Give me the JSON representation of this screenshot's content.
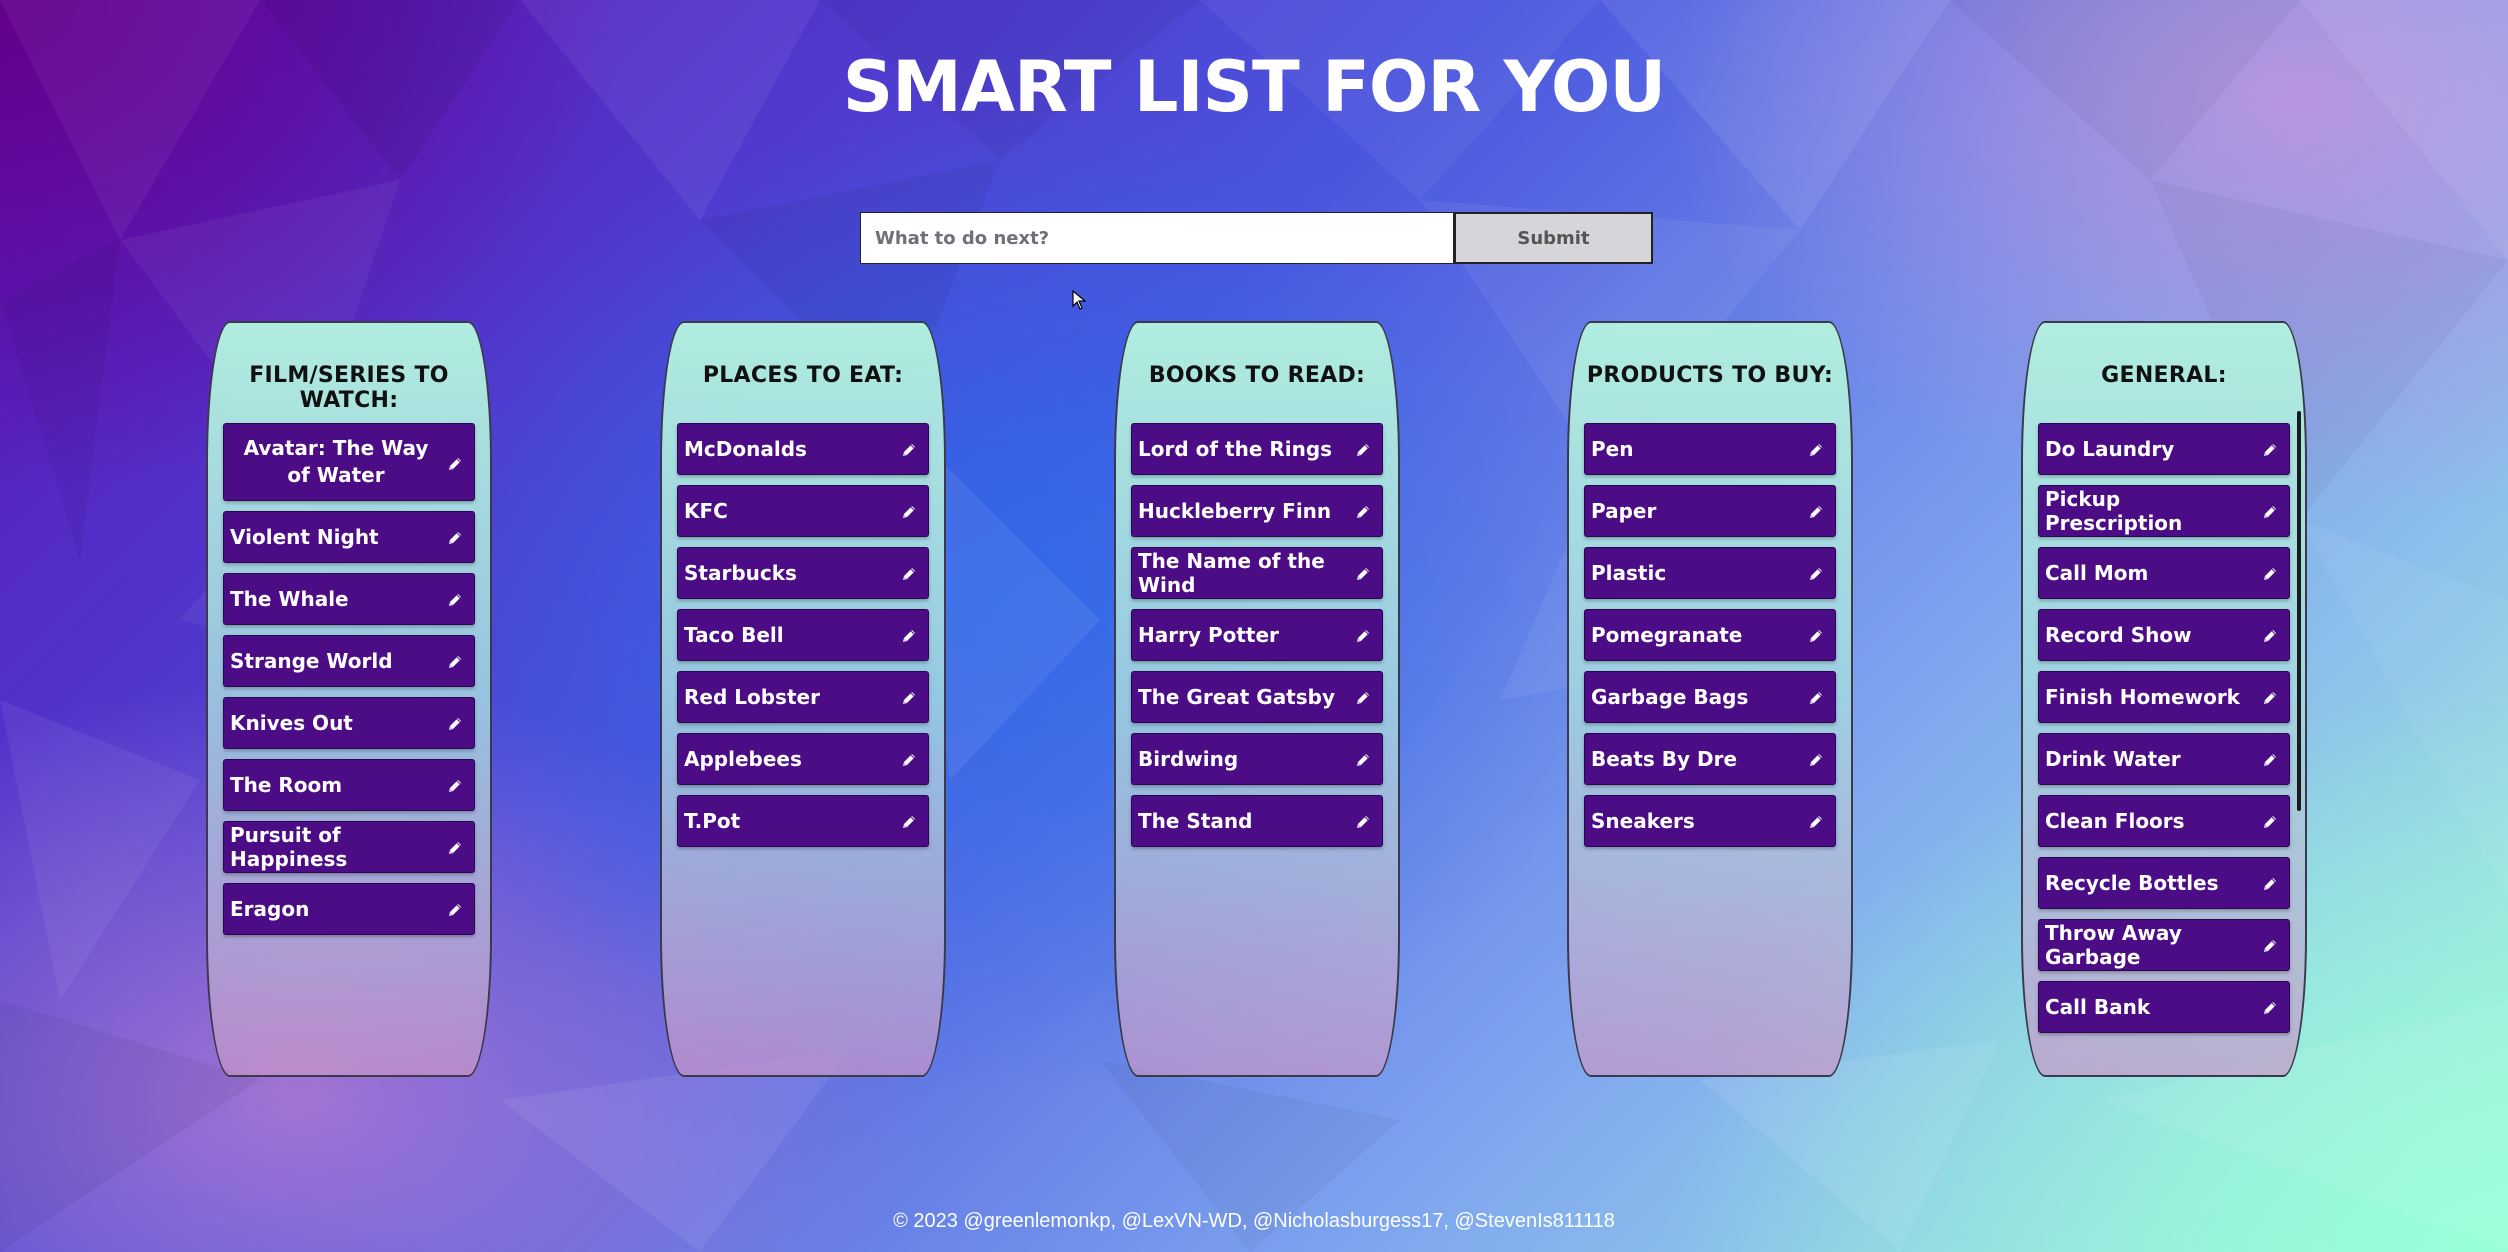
{
  "header": {
    "title": "SMART LIST FOR YOU"
  },
  "form": {
    "placeholder": "What to do next?",
    "submit_label": "Submit"
  },
  "columns": [
    {
      "title": "FILM/SERIES TO WATCH:",
      "items": [
        "Avatar: The Way of Water",
        "Violent Night",
        "The Whale",
        "Strange World",
        "Knives Out",
        "The Room",
        "Pursuit of Happiness",
        "Eragon"
      ]
    },
    {
      "title": "PLACES TO EAT:",
      "items": [
        "McDonalds",
        "KFC",
        "Starbucks",
        "Taco Bell",
        "Red Lobster",
        "Applebees",
        "T.Pot"
      ]
    },
    {
      "title": "BOOKS TO READ:",
      "items": [
        "Lord of the Rings",
        "Huckleberry Finn",
        "The Name of the Wind",
        "Harry Potter",
        "The Great Gatsby",
        "Birdwing",
        "The Stand"
      ]
    },
    {
      "title": "PRODUCTS TO BUY:",
      "items": [
        "Pen",
        "Paper",
        "Plastic",
        "Pomegranate",
        "Garbage Bags",
        "Beats By Dre",
        "Sneakers"
      ]
    },
    {
      "title": "GENERAL:",
      "items": [
        "Do Laundry",
        "Pickup Prescription",
        "Call Mom",
        "Record Show",
        "Finish Homework",
        "Drink Water",
        "Clean Floors",
        "Recycle Bottles",
        "Throw Away Garbage",
        "Call Bank"
      ]
    }
  ],
  "footer": {
    "credits": "© 2023 @greenlemonkp, @LexVN-WD, @Nicholasburgess17, @StevenIs811118"
  },
  "icons": {
    "edit": "pencil-icon"
  }
}
